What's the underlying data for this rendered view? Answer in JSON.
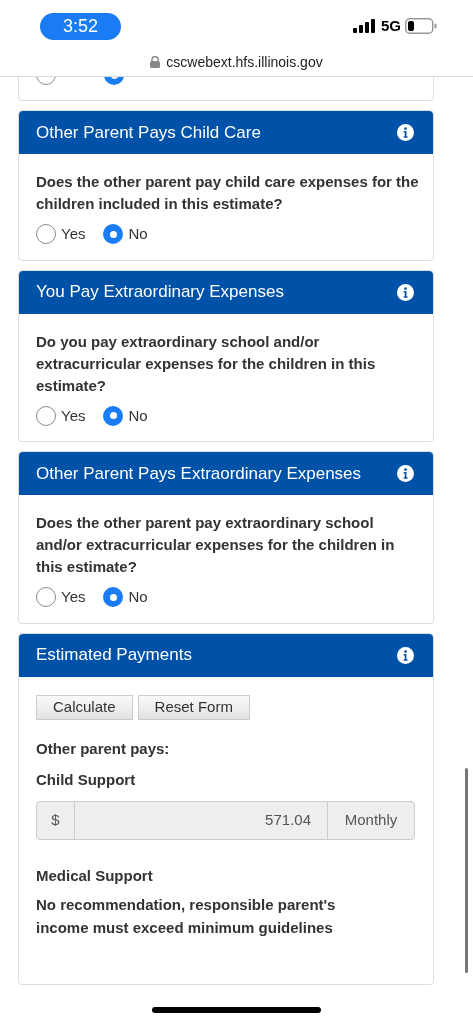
{
  "status_bar": {
    "time": "3:52",
    "network": "5G"
  },
  "address_bar": {
    "url": "cscwebext.hfs.illinois.gov"
  },
  "partial_card": {
    "options": [
      {
        "selected": false
      },
      {
        "selected": true
      }
    ]
  },
  "cards": [
    {
      "title": "Other Parent Pays Child Care",
      "question": "Does the other parent pay child care expenses for the children included in this estimate?",
      "options": [
        {
          "label": "Yes",
          "selected": false
        },
        {
          "label": "No",
          "selected": true
        }
      ]
    },
    {
      "title": "You Pay Extraordinary Expenses",
      "question": "Do you pay extraordinary school and/or extracurricular expenses for the children in this estimate?",
      "options": [
        {
          "label": "Yes",
          "selected": false
        },
        {
          "label": "No",
          "selected": true
        }
      ]
    },
    {
      "title": "Other Parent Pays Extraordinary Expenses",
      "question": "Does the other parent pay extraordinary school and/or extracurricular expenses for the children in this estimate?",
      "options": [
        {
          "label": "Yes",
          "selected": false
        },
        {
          "label": "No",
          "selected": true
        }
      ]
    }
  ],
  "estimate": {
    "title": "Estimated Payments",
    "buttons": [
      "Calculate",
      "Reset Form"
    ],
    "payer_label": "Other parent pays:",
    "child_support": {
      "label": "Child Support",
      "prefix": "$",
      "value": "571.04",
      "suffix": "Monthly"
    },
    "medical_support": {
      "label": "Medical Support",
      "text": "No recommendation, responsible parent's income must exceed minimum guidelines"
    }
  }
}
